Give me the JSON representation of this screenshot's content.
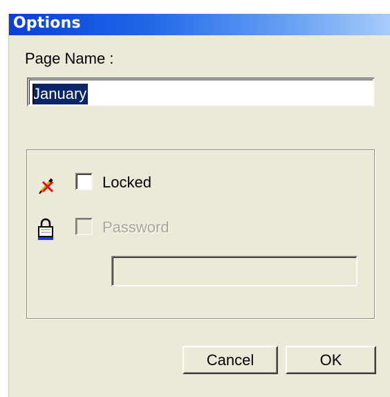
{
  "window": {
    "title": "Options"
  },
  "page_name": {
    "label": "Page Name :",
    "value": "January"
  },
  "options": {
    "locked": {
      "label": "Locked",
      "checked": false,
      "enabled": true,
      "icon": "pencil-no-edit-icon"
    },
    "password": {
      "label": "Password",
      "checked": false,
      "enabled": false,
      "icon": "padlock-icon",
      "value": ""
    }
  },
  "buttons": {
    "cancel": "Cancel",
    "ok": "OK"
  },
  "colors": {
    "titlebar_start": "#0a3fd6",
    "titlebar_end": "#a8ccfa",
    "dialog_bg": "#ece9d8",
    "selection_bg": "#0a246a",
    "disabled_text": "#a7a59c"
  }
}
